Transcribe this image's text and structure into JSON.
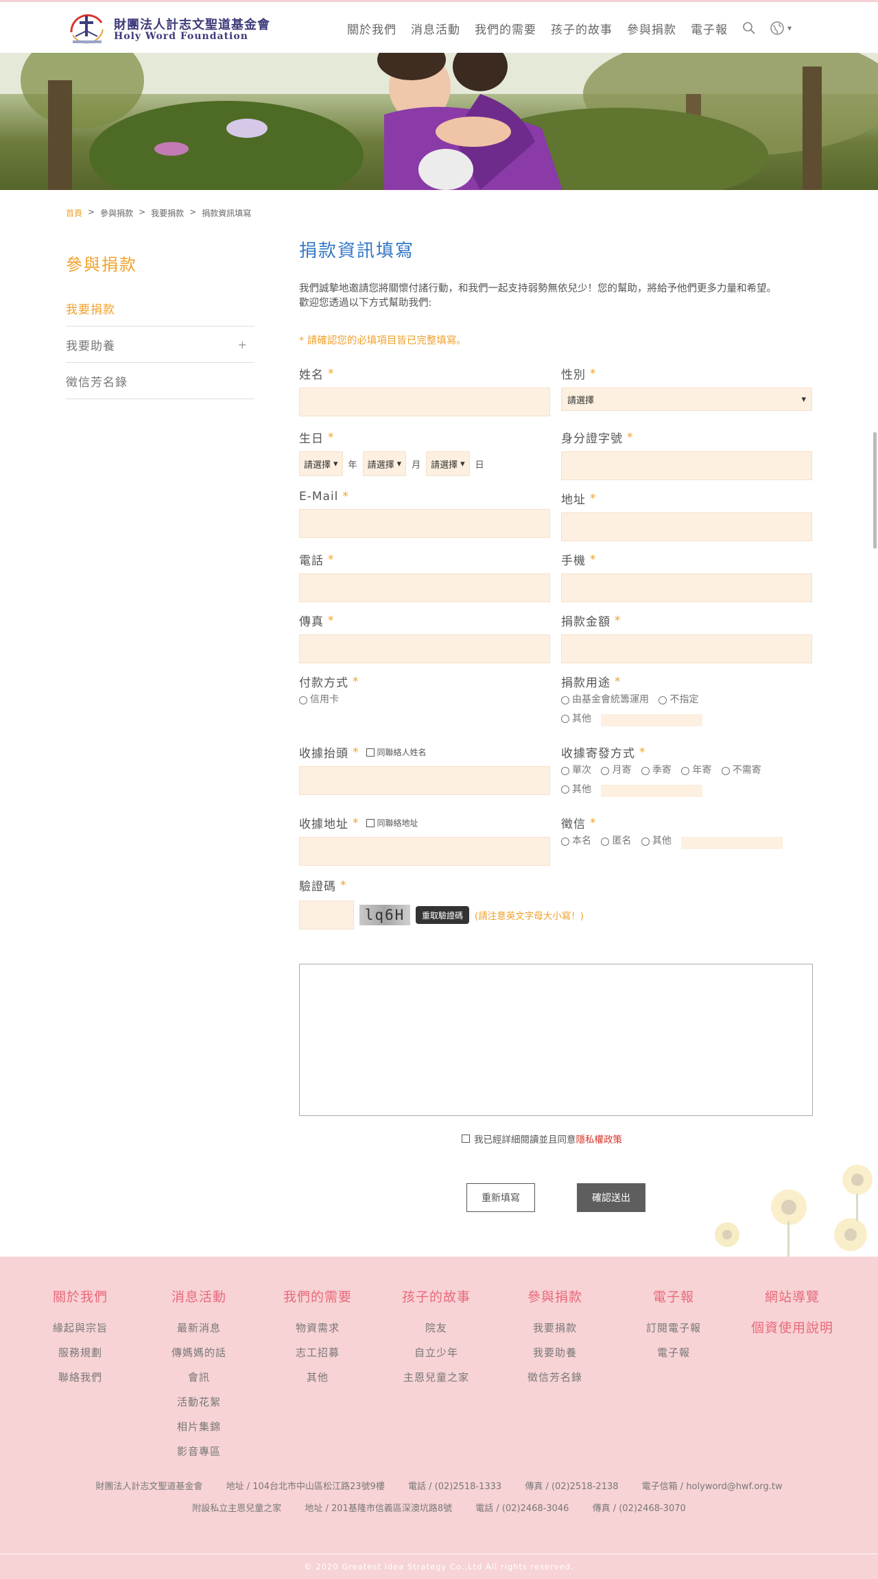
{
  "header": {
    "logo_cn": "財團法人計志文聖道基金會",
    "logo_en": "Holy Word Foundation",
    "nav": [
      "關於我們",
      "消息活動",
      "我們的需要",
      "孩子的故事",
      "參與捐款",
      "電子報"
    ],
    "lang_caret": "▾"
  },
  "breadcrumb": [
    "首頁",
    "參與捐款",
    "我要捐款",
    "捐款資訊填寫"
  ],
  "breadcrumb_sep": ">",
  "sidebar": {
    "title": "參與捐款",
    "items": [
      {
        "label": "我要捐款"
      },
      {
        "label": "我要助養",
        "expand": "+"
      },
      {
        "label": "徵信芳名錄"
      }
    ]
  },
  "form": {
    "title": "捐款資訊填寫",
    "intro_line1": "我們誠摯地邀請您將關懷付諸行動，和我們一起支持弱勢無依兒少！您的幫助，將給予他們更多力量和希望。",
    "intro_line2": "歡迎您透過以下方式幫助我們:",
    "required_note": "* 請確認您的必填項目皆已完整填寫。",
    "required_mark": "*",
    "fields": {
      "name": "姓名",
      "gender": "性別",
      "gender_select": "請選擇",
      "birthday": "生日",
      "birthday_select": "請選擇",
      "year": "年",
      "month": "月",
      "day": "日",
      "id_number": "身分證字號",
      "email": "E-Mail",
      "address": "地址",
      "phone": "電話",
      "mobile": "手機",
      "fax": "傳真",
      "amount": "捐款金額",
      "payment": "付款方式",
      "payment_options": [
        "信用卡"
      ],
      "usage": "捐款用途",
      "usage_options": [
        "由基金會統籌運用",
        "不指定",
        "其他"
      ],
      "receipt_title": "收據抬頭",
      "receipt_title_check": "同聯絡人姓名",
      "receipt_send": "收據寄發方式",
      "receipt_send_options": [
        "單次",
        "月寄",
        "季寄",
        "年寄",
        "不需寄",
        "其他"
      ],
      "receipt_address": "收據地址",
      "receipt_address_check": "同聯絡地址",
      "credit": "徵信",
      "credit_options": [
        "本名",
        "匿名",
        "其他"
      ],
      "captcha": "驗證碼",
      "captcha_text": "lq6H",
      "captcha_refresh": "重取驗證碼",
      "captcha_note": "(請注意英文字母大小寫！)"
    },
    "agree_text": "我已經詳細閱讀並且同意",
    "agree_link": "隱私權政策",
    "reset_button": "重新填寫",
    "submit_button": "確認送出"
  },
  "footer": {
    "columns": [
      {
        "title": "關於我們",
        "items": [
          "緣起與宗旨",
          "服務規劃",
          "聯絡我們"
        ]
      },
      {
        "title": "消息活動",
        "items": [
          "最新消息",
          "傳媽媽的話",
          "會訊",
          "活動花絮",
          "相片集錦",
          "影音專區"
        ]
      },
      {
        "title": "我們的需要",
        "items": [
          "物資需求",
          "志工招募",
          "其他"
        ]
      },
      {
        "title": "孩子的故事",
        "items": [
          "院友",
          "自立少年",
          "主恩兒童之家"
        ]
      },
      {
        "title": "參與捐款",
        "items": [
          "我要捐款",
          "我要助養",
          "徵信芳名錄"
        ]
      },
      {
        "title": "電子報",
        "items": [
          "訂閱電子報",
          "電子報"
        ]
      },
      {
        "title": "網站導覽",
        "items": [
          "個資使用說明"
        ]
      }
    ],
    "info_line1": [
      "財團法人計志文聖道基金會",
      "地址 / 104台北市中山區松江路23號9樓",
      "電話 / (02)2518-1333",
      "傳真 / (02)2518-2138",
      "電子信箱 / holyword@hwf.org.tw"
    ],
    "info_line2": [
      "附設私立主恩兒童之家",
      "地址 / 201基隆市信義區深澳坑路8號",
      "電話 / (02)2468-3046",
      "傳真 / (02)2468-3070"
    ],
    "copyright": "© 2020 Greatest Idea Strategy Co.,Ltd All rights reserved."
  }
}
